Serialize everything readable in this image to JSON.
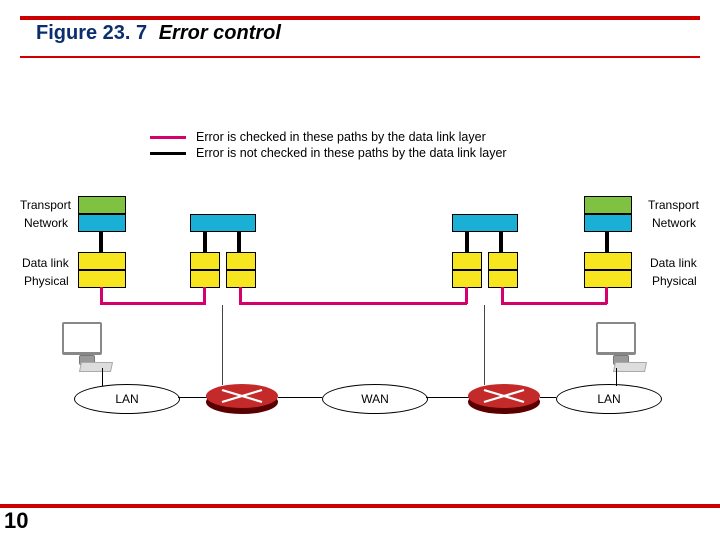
{
  "figure": {
    "number": "Figure 23. 7",
    "caption": "Error control"
  },
  "page_number": "10",
  "legend": {
    "checked": {
      "color": "#d6006c",
      "text": "Error is checked in these paths by the data link layer"
    },
    "unchecked": {
      "color": "#000000",
      "text": "Error is not checked in these paths by the data link layer"
    }
  },
  "layers": {
    "left": {
      "transport": "Transport",
      "network": "Network",
      "datalink": "Data link",
      "physical": "Physical"
    },
    "right": {
      "transport": "Transport",
      "network": "Network",
      "datalink": "Data link",
      "physical": "Physical"
    }
  },
  "networks": {
    "lan_left": "LAN",
    "wan": "WAN",
    "lan_right": "LAN"
  },
  "colors": {
    "accent_red": "#c00",
    "magenta": "#d6006c",
    "green": "#7fc241",
    "cyan": "#1ab0d6",
    "yellow": "#f7e520"
  }
}
